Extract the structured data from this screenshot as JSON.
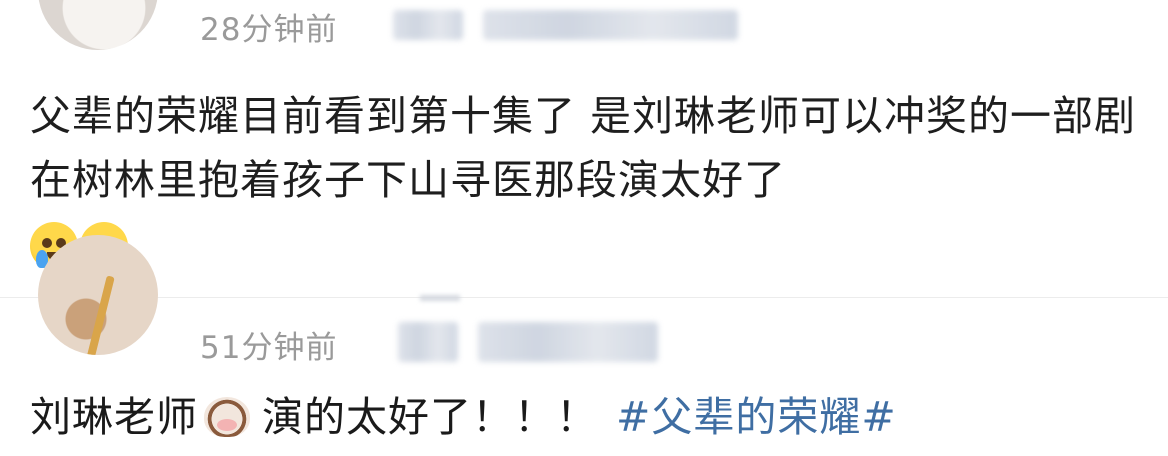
{
  "comments": [
    {
      "time": "28分钟前",
      "content": "父辈的荣耀目前看到第十集了 是刘琳老师可以冲奖的一部剧 在树林里抱着孩子下山寻医那段演太好了",
      "emojis": [
        "crying-face",
        "crying-face"
      ]
    },
    {
      "time": "51分钟前",
      "content_prefix": "刘琳老师",
      "content_emoji": "cow-face",
      "content_suffix": "演的太好了！！！",
      "hashtag": "#父辈的荣耀#"
    }
  ],
  "colors": {
    "hashtag": "#3f6ea3",
    "meta_text": "#9a9a9a",
    "body_text": "#1e1e1e"
  }
}
